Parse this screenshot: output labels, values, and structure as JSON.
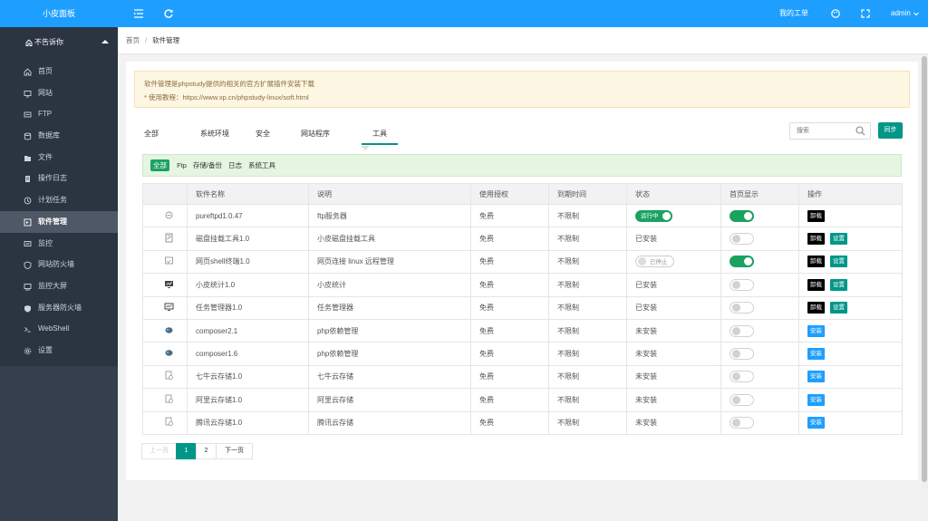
{
  "app": {
    "title": "小皮面板"
  },
  "topbar": {
    "tickets": "我的工单",
    "user": "admin"
  },
  "sidebar": {
    "user_label": "不告诉你",
    "items": [
      {
        "label": "首页",
        "icon": "home-icon"
      },
      {
        "label": "网站",
        "icon": "monitor-icon"
      },
      {
        "label": "FTP",
        "icon": "ftp-icon"
      },
      {
        "label": "数据库",
        "icon": "database-icon"
      },
      {
        "label": "文件",
        "icon": "folder-icon"
      },
      {
        "label": "操作日志",
        "icon": "log-icon"
      },
      {
        "label": "计划任务",
        "icon": "clock-icon"
      },
      {
        "label": "软件管理",
        "icon": "software-icon",
        "active": true
      },
      {
        "label": "监控",
        "icon": "monitor-chart-icon"
      },
      {
        "label": "网站防火墙",
        "icon": "shield-icon"
      },
      {
        "label": "监控大屏",
        "icon": "screen-icon"
      },
      {
        "label": "服务器防火墙",
        "icon": "server-shield-icon"
      },
      {
        "label": "WebShell",
        "icon": "terminal-icon"
      },
      {
        "label": "设置",
        "icon": "gear-icon"
      }
    ]
  },
  "breadcrumb": {
    "home": "首页",
    "sep": "/",
    "current": "软件管理"
  },
  "notice": {
    "line1": "软件管理是phpstudy提供的相关的官方扩展插件安装下载",
    "line2": "* 使用教程：https://www.xp.cn/phpstudy-linux/soft.html"
  },
  "tabs": [
    "全部",
    "系统环境",
    "安全",
    "网站程序",
    "工具"
  ],
  "search": {
    "placeholder": "搜索"
  },
  "sync_label": "同步",
  "subfilter": {
    "active": "全部",
    "options": [
      "Ftp",
      "存储/备份",
      "日志",
      "系统工具"
    ]
  },
  "table": {
    "headers": [
      "",
      "软件名称",
      "说明",
      "使用授权",
      "到期时间",
      "状态",
      "首页显示",
      "操作"
    ],
    "rows": [
      {
        "icon": "ftp-soft-icon",
        "name": "pureftpd1.0.47",
        "desc": "ftp服务器",
        "license": "免费",
        "expire": "不限制",
        "status": "运行中",
        "status_type": "running",
        "home": true,
        "actions": [
          "卸载"
        ]
      },
      {
        "icon": "disk-icon",
        "name": "磁盘挂载工具1.0",
        "desc": "小皮磁盘挂载工具",
        "license": "免费",
        "expire": "不限制",
        "status": "已安装",
        "status_type": "text",
        "home": false,
        "actions": [
          "卸载",
          "设置"
        ]
      },
      {
        "icon": "shell-icon",
        "name": "网页shell终端1.0",
        "desc": "网页连接 linux 远程管理",
        "license": "免费",
        "expire": "不限制",
        "status": "已停止",
        "status_type": "stopped",
        "home": true,
        "actions": [
          "卸载",
          "设置"
        ]
      },
      {
        "icon": "stats-icon",
        "name": "小皮统计1.0",
        "desc": "小皮统计",
        "license": "免费",
        "expire": "不限制",
        "status": "已安装",
        "status_type": "text",
        "home": false,
        "actions": [
          "卸载",
          "设置"
        ]
      },
      {
        "icon": "task-manager-icon",
        "name": "任务管理器1.0",
        "desc": "任务管理器",
        "license": "免费",
        "expire": "不限制",
        "status": "已安装",
        "status_type": "text",
        "home": false,
        "actions": [
          "卸载",
          "设置"
        ]
      },
      {
        "icon": "composer-icon",
        "name": "composer2.1",
        "desc": "php依赖管理",
        "license": "免费",
        "expire": "不限制",
        "status": "未安装",
        "status_type": "text",
        "home": false,
        "actions": [
          "安装"
        ]
      },
      {
        "icon": "composer-icon",
        "name": "composer1.6",
        "desc": "php依赖管理",
        "license": "免费",
        "expire": "不限制",
        "status": "未安装",
        "status_type": "text",
        "home": false,
        "actions": [
          "安装"
        ]
      },
      {
        "icon": "cloud-storage-icon",
        "name": "七牛云存储1.0",
        "desc": "七牛云存储",
        "license": "免费",
        "expire": "不限制",
        "status": "未安装",
        "status_type": "text",
        "home": false,
        "actions": [
          "安装"
        ]
      },
      {
        "icon": "cloud-storage-icon",
        "name": "阿里云存储1.0",
        "desc": "阿里云存储",
        "license": "免费",
        "expire": "不限制",
        "status": "未安装",
        "status_type": "text",
        "home": false,
        "actions": [
          "安装"
        ]
      },
      {
        "icon": "cloud-storage-icon",
        "name": "腾讯云存储1.0",
        "desc": "腾讯云存储",
        "license": "免费",
        "expire": "不限制",
        "status": "未安装",
        "status_type": "text",
        "home": false,
        "actions": [
          "安装"
        ]
      }
    ]
  },
  "pager": {
    "prev": "上一页",
    "pages": [
      "1",
      "2"
    ],
    "current": "1",
    "next": "下一页"
  }
}
